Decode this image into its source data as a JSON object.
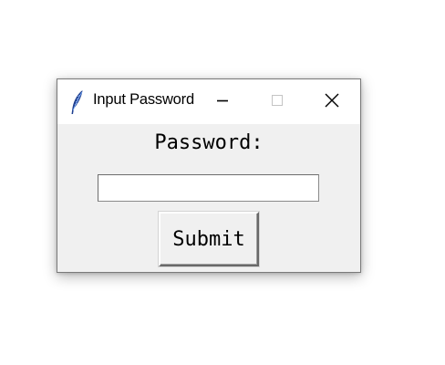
{
  "window": {
    "title": "Input Password",
    "app_icon": "feather-icon",
    "controls": {
      "minimize_icon": "minimize-icon",
      "maximize_icon": "maximize-icon",
      "close_icon": "close-icon"
    }
  },
  "form": {
    "label": "Password:",
    "password_value": "",
    "submit_label": "Submit"
  },
  "colors": {
    "window_background": "#f0f0f0",
    "titlebar_background": "#ffffff",
    "feather_blue": "#1f3f8f"
  }
}
